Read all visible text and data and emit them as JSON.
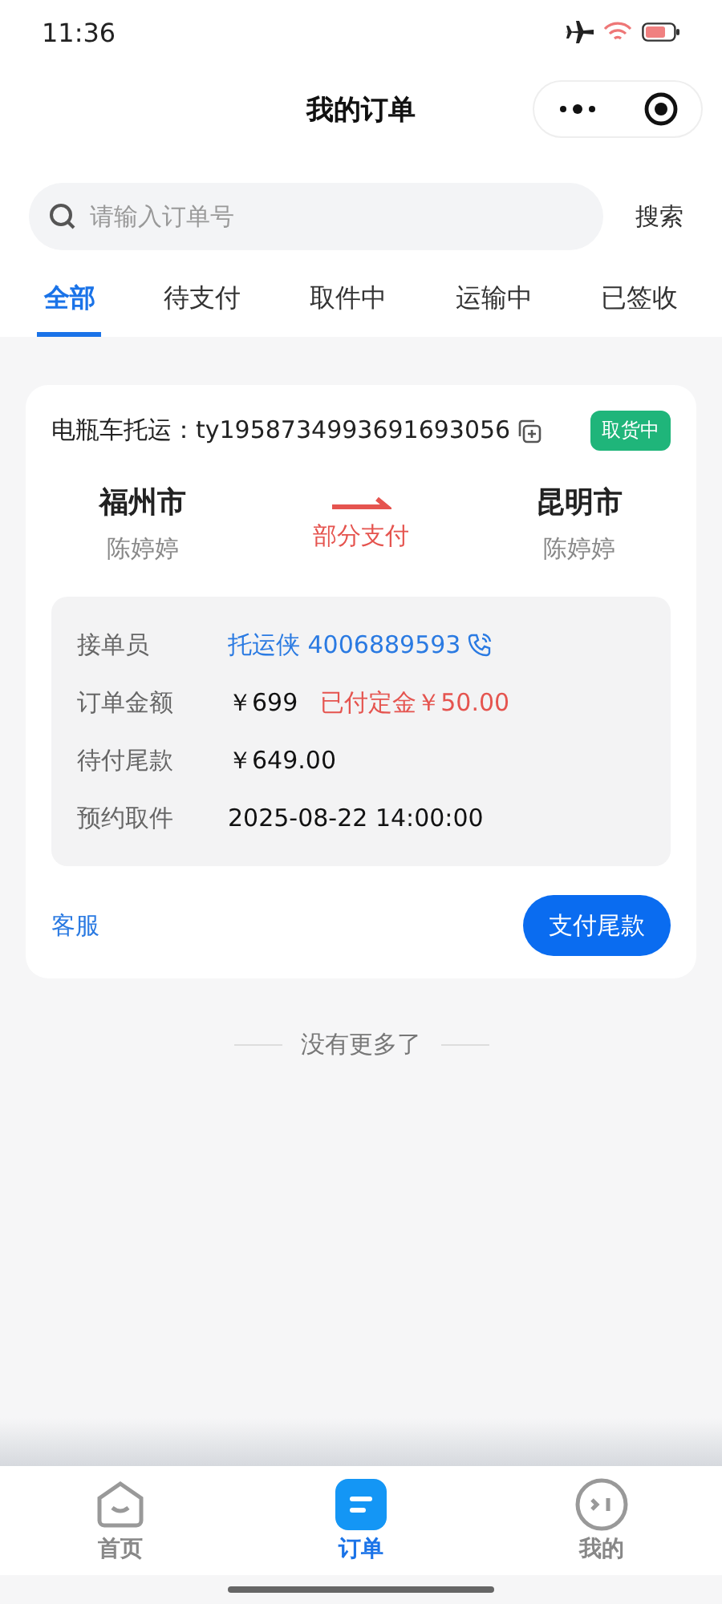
{
  "status_bar": {
    "time": "11:36"
  },
  "header": {
    "title": "我的订单"
  },
  "search": {
    "placeholder": "请输入订单号",
    "button": "搜索"
  },
  "tabs": [
    {
      "label": "全部",
      "selected": true
    },
    {
      "label": "待支付",
      "selected": false
    },
    {
      "label": "取件中",
      "selected": false
    },
    {
      "label": "运输中",
      "selected": false
    },
    {
      "label": "已签收",
      "selected": false
    }
  ],
  "orders": [
    {
      "category": "电瓶车托运：",
      "order_no": "ty1958734993691693056",
      "status": "取货中",
      "from": {
        "city": "福州市",
        "name": "陈婷婷"
      },
      "to": {
        "city": "昆明市",
        "name": "陈婷婷"
      },
      "payment_status": "部分支付",
      "details": [
        {
          "kind": "contact",
          "label": "接单员",
          "value": "托运侠 4006889593"
        },
        {
          "kind": "amount",
          "label": "订单金额",
          "value": "￥699",
          "extra": "已付定金￥50.00"
        },
        {
          "kind": "plain",
          "label": "待付尾款",
          "value": "￥649.00"
        },
        {
          "kind": "plain",
          "label": "预约取件",
          "value": "2025-08-22 14:00:00"
        }
      ],
      "service_link": "客服",
      "pay_button": "支付尾款"
    }
  ],
  "end_text": "没有更多了",
  "bottom_nav": [
    {
      "kind": "home",
      "label": "首页",
      "selected": false
    },
    {
      "kind": "orders",
      "label": "订单",
      "selected": true
    },
    {
      "kind": "profile",
      "label": "我的",
      "selected": false
    }
  ]
}
